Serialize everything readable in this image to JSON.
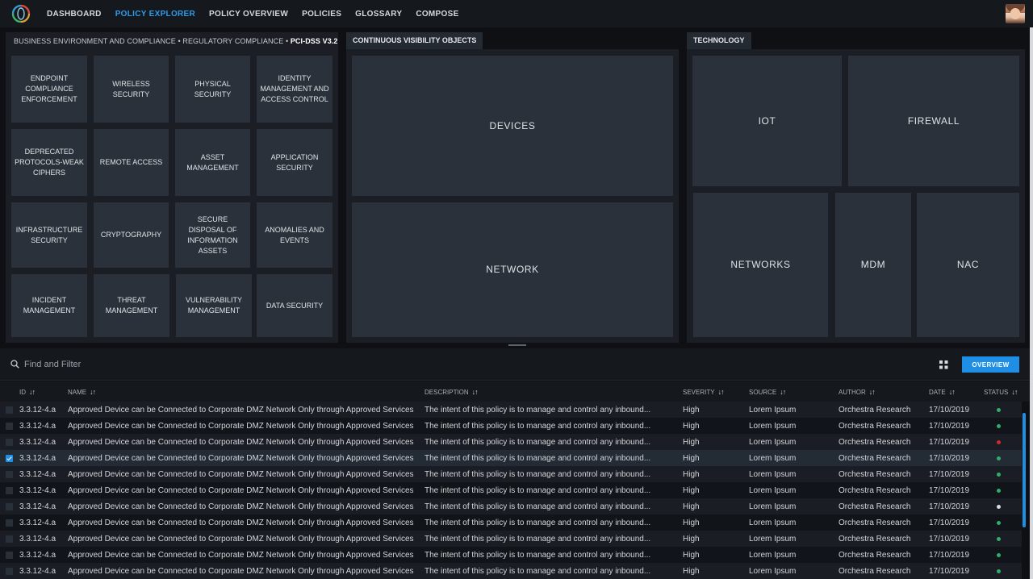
{
  "nav": {
    "items": [
      {
        "label": "DASHBOARD",
        "active": false
      },
      {
        "label": "POLICY EXPLORER",
        "active": true
      },
      {
        "label": "POLICY OVERVIEW",
        "active": false
      },
      {
        "label": "POLICIES",
        "active": false
      },
      {
        "label": "GLOSSARY",
        "active": false
      },
      {
        "label": "COMPOSE",
        "active": false
      }
    ]
  },
  "compliance": {
    "crumb1": "BUSINESS ENVIRONMENT AND COMPLIANCE",
    "sep": "•",
    "crumb2": "REGULATORY COMPLIANCE",
    "crumb3": "PCI-DSS V3.2",
    "tiles": [
      "ENDPOINT COMPLIANCE ENFORCEMENT",
      "WIRELESS SECURITY",
      "PHYSICAL SECURITY",
      "IDENTITY MANAGEMENT AND ACCESS CONTROL",
      "DEPRECATED PROTOCOLS-WEAK CIPHERS",
      "REMOTE ACCESS",
      "ASSET MANAGEMENT",
      "APPLICATION SECURITY",
      "INFRASTRUCTURE SECURITY",
      "CRYPTOGRAPHY",
      "SECURE DISPOSAL OF INFORMATION ASSETS",
      "ANOMALIES AND EVENTS",
      "INCIDENT MANAGEMENT",
      "THREAT MANAGEMENT",
      "VULNERABILITY MANAGEMENT",
      "DATA SECURITY"
    ]
  },
  "visibility": {
    "title": "CONTINUOUS VISIBILITY OBJECTS",
    "tiles": [
      "DEVICES",
      "NETWORK"
    ]
  },
  "technology": {
    "title": "TECHNOLOGY",
    "tiles": [
      "IOT",
      "FIREWALL",
      "NETWORKS",
      "MDM",
      "NAC"
    ]
  },
  "filter": {
    "placeholder": "Find and Filter",
    "overview_label": "OVERVIEW"
  },
  "table": {
    "columns": {
      "id": "ID",
      "name": "NAME",
      "description": "DESCRIPTION",
      "severity": "SEVERITY",
      "source": "SOURCE",
      "author": "AUTHOR",
      "date": "DATE",
      "status": "STATUS"
    },
    "sort_glyph": "↓↑",
    "rows": [
      {
        "id": "3.3.12-4.a",
        "name": "Approved Device can be Connected to Corporate DMZ Network Only through Approved Services",
        "description": "The intent of this policy is to manage and control any inbound...",
        "severity": "High",
        "source": "Lorem Ipsum",
        "author": "Orchestra Research",
        "date": "17/10/2019",
        "status_color": "#2fae6b",
        "checked": false
      },
      {
        "id": "3.3.12-4.a",
        "name": "Approved Device can be Connected to Corporate DMZ Network Only through Approved Services",
        "description": "The intent of this policy is to manage and control any inbound...",
        "severity": "High",
        "source": "Lorem Ipsum",
        "author": "Orchestra Research",
        "date": "17/10/2019",
        "status_color": "#2fae6b",
        "checked": false
      },
      {
        "id": "3.3.12-4.a",
        "name": "Approved Device can be Connected to Corporate DMZ Network Only through Approved Services",
        "description": "The intent of this policy is to manage and control any inbound...",
        "severity": "High",
        "source": "Lorem Ipsum",
        "author": "Orchestra Research",
        "date": "17/10/2019",
        "status_color": "#d02a2a",
        "checked": false
      },
      {
        "id": "3.3.12-4.a",
        "name": "Approved Device can be Connected to Corporate DMZ Network Only through Approved Services",
        "description": "The intent of this policy is to manage and control any inbound...",
        "severity": "High",
        "source": "Lorem Ipsum",
        "author": "Orchestra Research",
        "date": "17/10/2019",
        "status_color": "#2fae6b",
        "checked": true
      },
      {
        "id": "3.3.12-4.a",
        "name": "Approved Device can be Connected to Corporate DMZ Network Only through Approved Services",
        "description": "The intent of this policy is to manage and control any inbound...",
        "severity": "High",
        "source": "Lorem Ipsum",
        "author": "Orchestra Research",
        "date": "17/10/2019",
        "status_color": "#2fae6b",
        "checked": false
      },
      {
        "id": "3.3.12-4.a",
        "name": "Approved Device can be Connected to Corporate DMZ Network Only through Approved Services",
        "description": "The intent of this policy is to manage and control any inbound...",
        "severity": "High",
        "source": "Lorem Ipsum",
        "author": "Orchestra Research",
        "date": "17/10/2019",
        "status_color": "#2fae6b",
        "checked": false
      },
      {
        "id": "3.3.12-4.a",
        "name": "Approved Device can be Connected to Corporate DMZ Network Only through Approved Services",
        "description": "The intent of this policy is to manage and control any inbound...",
        "severity": "High",
        "source": "Lorem Ipsum",
        "author": "Orchestra Research",
        "date": "17/10/2019",
        "status_color": "#d9dde1",
        "checked": false
      },
      {
        "id": "3.3.12-4.a",
        "name": "Approved Device can be Connected to Corporate DMZ Network Only through Approved Services",
        "description": "The intent of this policy is to manage and control any inbound...",
        "severity": "High",
        "source": "Lorem Ipsum",
        "author": "Orchestra Research",
        "date": "17/10/2019",
        "status_color": "#2fae6b",
        "checked": false
      },
      {
        "id": "3.3.12-4.a",
        "name": "Approved Device can be Connected to Corporate DMZ Network Only through Approved Services",
        "description": "The intent of this policy is to manage and control any inbound...",
        "severity": "High",
        "source": "Lorem Ipsum",
        "author": "Orchestra Research",
        "date": "17/10/2019",
        "status_color": "#2fae6b",
        "checked": false
      },
      {
        "id": "3.3.12-4.a",
        "name": "Approved Device can be Connected to Corporate DMZ Network Only through Approved Services",
        "description": "The intent of this policy is to manage and control any inbound...",
        "severity": "High",
        "source": "Lorem Ipsum",
        "author": "Orchestra Research",
        "date": "17/10/2019",
        "status_color": "#2fae6b",
        "checked": false
      },
      {
        "id": "3.3.12-4.a",
        "name": "Approved Device can be Connected to Corporate DMZ Network Only through Approved Services",
        "description": "The intent of this policy is to manage and control any inbound...",
        "severity": "High",
        "source": "Lorem Ipsum",
        "author": "Orchestra Research",
        "date": "17/10/2019",
        "status_color": "#2fae6b",
        "checked": false
      }
    ]
  },
  "colors": {
    "accent": "#1f8fe6",
    "nav_active": "#2f9be8",
    "status_ok": "#2fae6b",
    "status_error": "#d02a2a",
    "status_unknown": "#d9dde1"
  }
}
